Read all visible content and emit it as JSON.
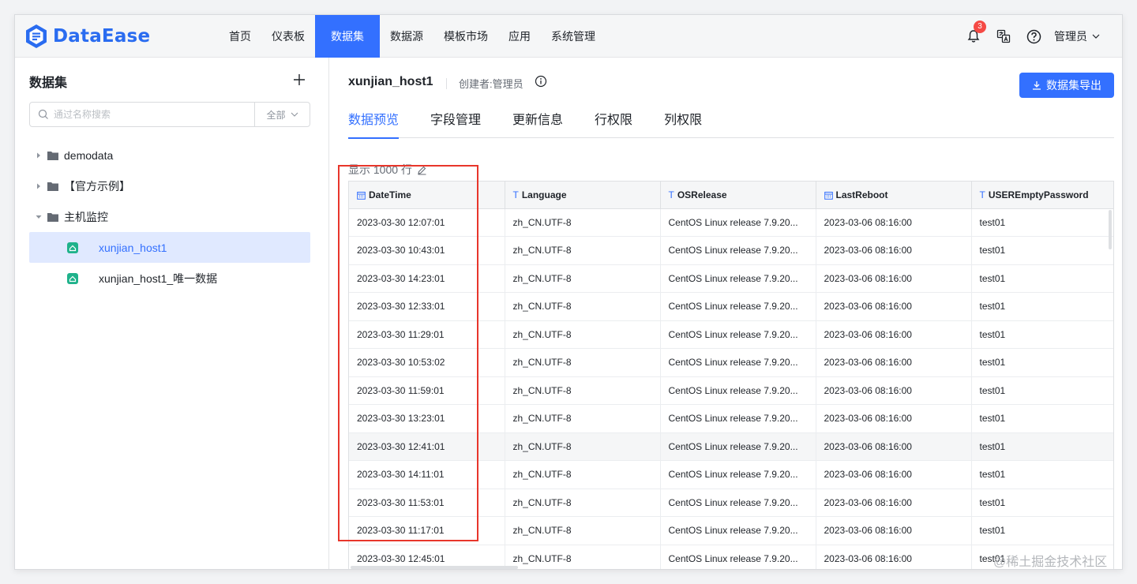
{
  "app": {
    "logo_text": "DataEase",
    "brand_color": "#3370ff"
  },
  "nav": {
    "items": [
      "首页",
      "仪表板",
      "数据集",
      "数据源",
      "模板市场",
      "应用",
      "系统管理"
    ],
    "active": "数据集"
  },
  "header": {
    "notification_count": "3",
    "user_label": "管理员"
  },
  "sidebar": {
    "title": "数据集",
    "search_placeholder": "通过名称搜索",
    "filter_label": "全部",
    "tree": [
      {
        "label": "demodata",
        "type": "folder",
        "expanded": false
      },
      {
        "label": "【官方示例】",
        "type": "folder",
        "expanded": false
      },
      {
        "label": "主机监控",
        "type": "folder",
        "expanded": true
      },
      {
        "label": "xunjian_host1",
        "type": "dataset",
        "selected": true
      },
      {
        "label": "xunjian_host1_唯一数据",
        "type": "dataset",
        "selected": false
      }
    ]
  },
  "main": {
    "dataset_name": "xunjian_host1",
    "creator": "创建者:管理员",
    "export_label": "数据集导出",
    "tabs": [
      "数据预览",
      "字段管理",
      "更新信息",
      "行权限",
      "列权限"
    ],
    "active_tab": "数据预览",
    "rows_info": "显示 1000 行",
    "columns": [
      {
        "name": "DateTime",
        "type": "date"
      },
      {
        "name": "Language",
        "type": "text"
      },
      {
        "name": "OSRelease",
        "type": "text"
      },
      {
        "name": "LastReboot",
        "type": "date"
      },
      {
        "name": "USEREmptyPassword",
        "type": "text"
      }
    ],
    "rows": [
      [
        "2023-03-30 12:07:01",
        "zh_CN.UTF-8",
        "CentOS Linux release 7.9.20...",
        "2023-03-06 08:16:00",
        "test01"
      ],
      [
        "2023-03-30 10:43:01",
        "zh_CN.UTF-8",
        "CentOS Linux release 7.9.20...",
        "2023-03-06 08:16:00",
        "test01"
      ],
      [
        "2023-03-30 14:23:01",
        "zh_CN.UTF-8",
        "CentOS Linux release 7.9.20...",
        "2023-03-06 08:16:00",
        "test01"
      ],
      [
        "2023-03-30 12:33:01",
        "zh_CN.UTF-8",
        "CentOS Linux release 7.9.20...",
        "2023-03-06 08:16:00",
        "test01"
      ],
      [
        "2023-03-30 11:29:01",
        "zh_CN.UTF-8",
        "CentOS Linux release 7.9.20...",
        "2023-03-06 08:16:00",
        "test01"
      ],
      [
        "2023-03-30 10:53:02",
        "zh_CN.UTF-8",
        "CentOS Linux release 7.9.20...",
        "2023-03-06 08:16:00",
        "test01"
      ],
      [
        "2023-03-30 11:59:01",
        "zh_CN.UTF-8",
        "CentOS Linux release 7.9.20...",
        "2023-03-06 08:16:00",
        "test01"
      ],
      [
        "2023-03-30 13:23:01",
        "zh_CN.UTF-8",
        "CentOS Linux release 7.9.20...",
        "2023-03-06 08:16:00",
        "test01"
      ],
      [
        "2023-03-30 12:41:01",
        "zh_CN.UTF-8",
        "CentOS Linux release 7.9.20...",
        "2023-03-06 08:16:00",
        "test01"
      ],
      [
        "2023-03-30 14:11:01",
        "zh_CN.UTF-8",
        "CentOS Linux release 7.9.20...",
        "2023-03-06 08:16:00",
        "test01"
      ],
      [
        "2023-03-30 11:53:01",
        "zh_CN.UTF-8",
        "CentOS Linux release 7.9.20...",
        "2023-03-06 08:16:00",
        "test01"
      ],
      [
        "2023-03-30 11:17:01",
        "zh_CN.UTF-8",
        "CentOS Linux release 7.9.20...",
        "2023-03-06 08:16:00",
        "test01"
      ],
      [
        "2023-03-30 12:45:01",
        "zh_CN.UTF-8",
        "CentOS Linux release 7.9.20...",
        "2023-03-06 08:16:00",
        "test01"
      ]
    ],
    "hover_row_index": 8
  },
  "watermark": "@稀土掘金技术社区",
  "colors": {
    "accent": "#3370ff",
    "selected_bg": "#e0e9ff",
    "highlight_border": "#e8362b",
    "dataset_icon": "#1fb28b"
  }
}
